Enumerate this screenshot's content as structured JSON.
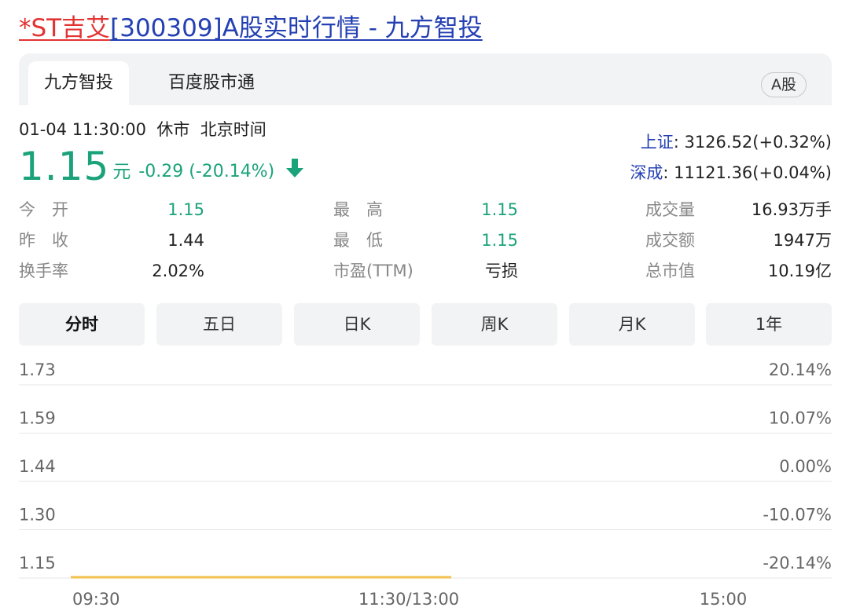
{
  "page_title": {
    "stock_name": "*ST吉艾",
    "rest": "[300309]A股实时行情 - 九方智投"
  },
  "tabs": [
    {
      "label": "九方智投",
      "active": true
    },
    {
      "label": "百度股市通",
      "active": false
    }
  ],
  "market_badge": "A股",
  "quote": {
    "time": "01-04 11:30:00",
    "status": "休市",
    "timezone": "北京时间",
    "price": "1.15",
    "unit": "元",
    "change": "-0.29 (-20.14%)",
    "trend": "down"
  },
  "indices": [
    {
      "name": "上证",
      "value": ": 3126.52(+0.32%)"
    },
    {
      "name": "深成",
      "value": ": 11121.36(+0.04%)"
    }
  ],
  "stats": {
    "open": {
      "label": "今　开",
      "value": "1.15"
    },
    "prev_close": {
      "label": "昨　收",
      "value": "1.44"
    },
    "turnover_rate": {
      "label": "换手率",
      "value": "2.02%"
    },
    "high": {
      "label": "最　高",
      "value": "1.15"
    },
    "low": {
      "label": "最　低",
      "value": "1.15"
    },
    "pe": {
      "label": "市盈(TTM)",
      "value": "亏损"
    },
    "volume": {
      "label": "成交量",
      "value": "16.93万手"
    },
    "amount": {
      "label": "成交额",
      "value": "1947万"
    },
    "market_cap": {
      "label": "总市值",
      "value": "10.19亿"
    }
  },
  "period_tabs": [
    {
      "label": "分时",
      "active": true
    },
    {
      "label": "五日",
      "active": false
    },
    {
      "label": "日K",
      "active": false
    },
    {
      "label": "周K",
      "active": false
    },
    {
      "label": "月K",
      "active": false
    },
    {
      "label": "1年",
      "active": false
    }
  ],
  "colors": {
    "down": "#1aa37a",
    "link_red": "#e33333",
    "link_blue": "#2440b3",
    "price_line": "#f2c14e",
    "grid": "#e6e6e6"
  },
  "chart_data": {
    "type": "line",
    "y_left_ticks": [
      "1.73",
      "1.59",
      "1.44",
      "1.30",
      "1.15"
    ],
    "y_right_ticks": [
      "20.14%",
      "10.07%",
      "0.00%",
      "-10.07%",
      "-20.14%"
    ],
    "ylim": [
      1.15,
      1.73
    ],
    "x_ticks": [
      "09:30",
      "11:30/13:00",
      "15:00"
    ],
    "session_fraction": [
      0,
      0.5
    ],
    "series": [
      {
        "values": [
          1.15,
          1.15
        ]
      }
    ]
  }
}
